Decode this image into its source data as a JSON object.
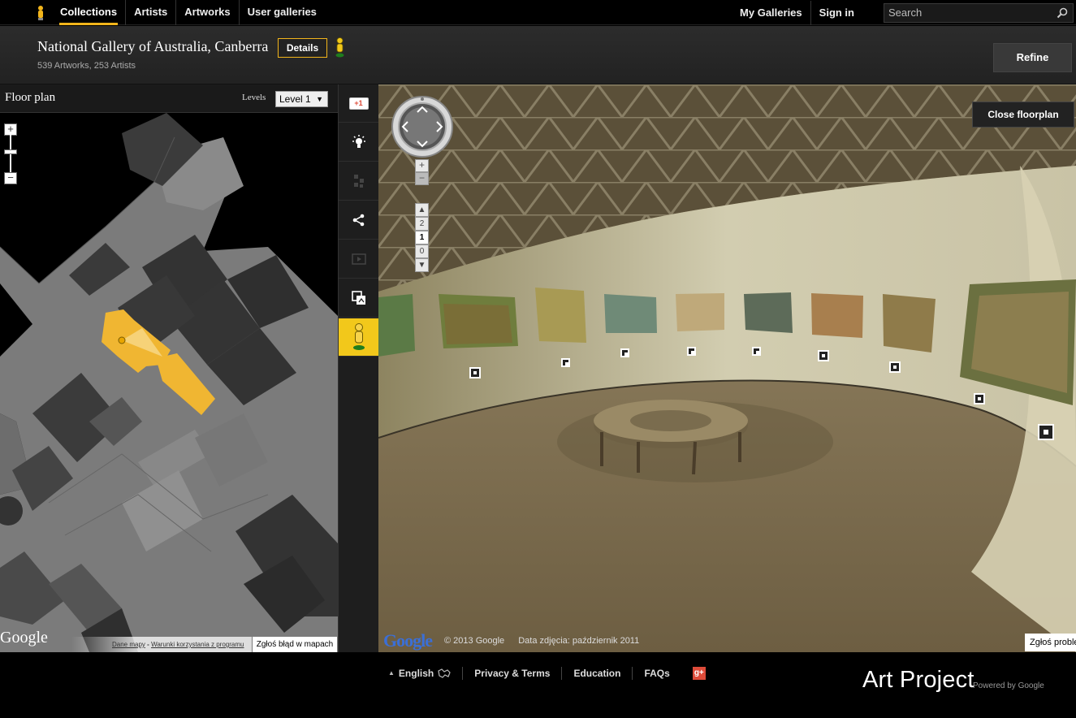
{
  "nav": {
    "items": [
      {
        "label": "Collections",
        "active": true
      },
      {
        "label": "Artists"
      },
      {
        "label": "Artworks"
      },
      {
        "label": "User galleries"
      }
    ],
    "my_galleries": "My Galleries",
    "sign_in": "Sign in",
    "search_placeholder": "Search"
  },
  "header": {
    "title": "National Gallery of Australia, Canberra",
    "details_label": "Details",
    "subtitle": "539 Artworks, 253 Artists",
    "refine_label": "Refine"
  },
  "floorplan": {
    "title": "Floor plan",
    "levels_label": "Levels",
    "selected_level": "Level 1",
    "google_logo": "Google",
    "map_data": "Dane mapy",
    "separator": "-",
    "terms": "Warunki korzystania z programu",
    "report": "Zgłoś błąd w mapach"
  },
  "tools": {
    "gplus_label": "+1"
  },
  "panorama": {
    "close_label": "Close floorplan",
    "floors": [
      "2",
      "1",
      "0"
    ],
    "current_floor": "1",
    "google_logo": "Google",
    "copyright": "© 2013 Google",
    "photo_date": "Data zdjęcia: październik 2011",
    "report": "Zgłoś problem"
  },
  "footer": {
    "language": "English",
    "privacy": "Privacy & Terms",
    "education": "Education",
    "faqs": "FAQs",
    "brand": "Art Project",
    "powered": "Powered by Google"
  },
  "colors": {
    "accent": "#f2b51b",
    "floor_highlight": "#f0b632",
    "gplus_red": "#dd4b39"
  },
  "icons": [
    "pegman-icon",
    "search-icon",
    "map-pin-icon",
    "lightbulb-icon",
    "share-icon",
    "grid-icon",
    "fullscreen-icon",
    "overlay-icon",
    "chevron-up-icon",
    "globe-icon"
  ]
}
